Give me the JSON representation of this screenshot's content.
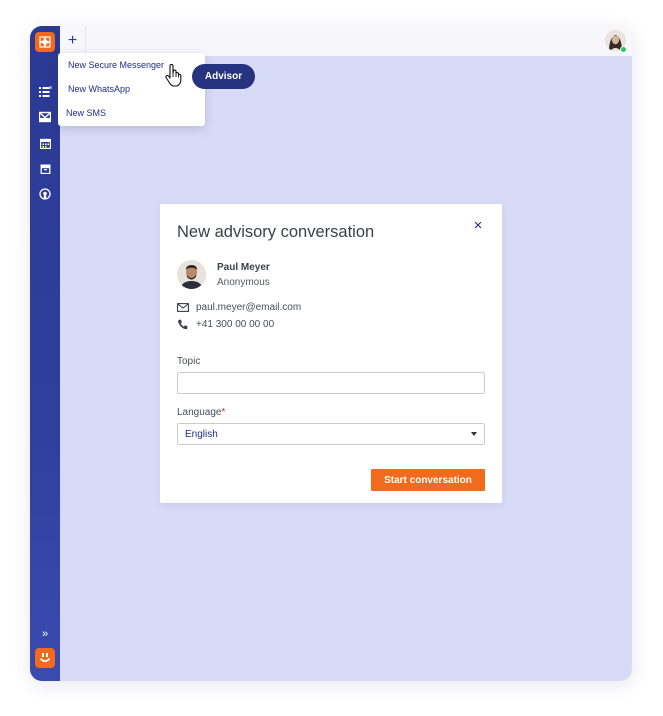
{
  "topbar": {
    "new_tab_label": "+"
  },
  "dropdown": {
    "items": [
      {
        "label": "New Secure Messenger"
      },
      {
        "label": "New WhatsApp"
      },
      {
        "label": "New SMS"
      }
    ]
  },
  "advisor_pill": {
    "label": "Advisor"
  },
  "modal": {
    "title": "New advisory conversation",
    "close_label": "×",
    "contact": {
      "name": "Paul Meyer",
      "status": "Anonymous",
      "email": "paul.meyer@email.com",
      "phone": "+41 300 00 00 00"
    },
    "topic": {
      "label": "Topic",
      "value": "",
      "placeholder": ""
    },
    "language": {
      "label": "Language",
      "required_mark": "*",
      "selected": "English"
    },
    "start_button": "Start conversation"
  },
  "sidebar": {
    "icons": [
      "list-icon",
      "inbox-icon",
      "calendar-icon",
      "archive-icon",
      "broadcast-icon"
    ],
    "expand_label": "»"
  },
  "colors": {
    "sidebar": "#2a3a93",
    "accent": "#f26a1b",
    "background": "#d8dbf7",
    "pill": "#26337f"
  }
}
